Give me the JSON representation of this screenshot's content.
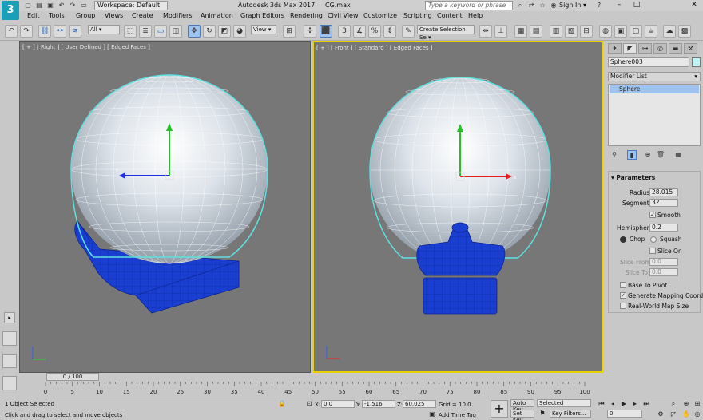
{
  "titlebar": {
    "workspace": "Workspace: Default",
    "app_title": "Autodesk 3ds Max 2017",
    "file_name": "CG.max",
    "search_placeholder": "Type a keyword or phrase",
    "sign_in": "Sign In"
  },
  "menu": [
    "Edit",
    "Tools",
    "Group",
    "Views",
    "Create",
    "Modifiers",
    "Animation",
    "Graph Editors",
    "Rendering",
    "Civil View",
    "Customize",
    "Scripting",
    "Content",
    "Help"
  ],
  "toolbar": {
    "filter_value": "All",
    "refcoord_value": "View",
    "selection_set": "Create Selection Se"
  },
  "viewports": {
    "right_label": "[ + ] [ Right ] [ User Defined ] [ Edged Faces ]",
    "front_label": "[ + ] [ Front ] [ Standard ] [ Edged Faces ]",
    "right_axis_z": "z",
    "front_axis_x": "x"
  },
  "command_panel": {
    "object_name": "Sphere003",
    "modifier_list": "Modifier List",
    "stack_item": "Sphere",
    "object_color": "#bff4f4",
    "rollout_title": "Parameters",
    "radius_label": "Radius:",
    "radius": "28.015",
    "segments_label": "Segments:",
    "segments": "32",
    "smooth": "Smooth",
    "hemisphere_label": "Hemisphere:",
    "hemisphere": "0.2",
    "chop": "Chop",
    "squash": "Squash",
    "slice_on": "Slice On",
    "slice_from_label": "Slice From:",
    "slice_from": "0.0",
    "slice_to_label": "Slice To:",
    "slice_to": "0.0",
    "base_to_pivot": "Base To Pivot",
    "gen_mapping": "Generate Mapping Coords.",
    "real_world": "Real-World Map Size"
  },
  "timeline": {
    "frame_display": "0 / 100",
    "ticks": [
      "0",
      "5",
      "10",
      "15",
      "20",
      "25",
      "30",
      "35",
      "40",
      "45",
      "50",
      "55",
      "60",
      "65",
      "70",
      "75",
      "80",
      "85",
      "90",
      "95",
      "100"
    ]
  },
  "status": {
    "selected": "1 Object Selected",
    "prompt": "Click and drag to select and move objects",
    "x_label": "X:",
    "x": "0.0",
    "y_label": "Y:",
    "y": "-1.516",
    "z_label": "Z:",
    "z": "60.025",
    "grid": "Grid = 10.0",
    "add_time_tag": "Add Time Tag",
    "auto_key": "Auto Key",
    "set_key": "Set Key",
    "selected_dd": "Selected",
    "key_filters": "Key Filters...",
    "frame": "0"
  },
  "colors": {
    "viewport_bg": "#777777",
    "active_border": "#e8d200",
    "sphere_wire": "#5fe0e0",
    "mesh_blue": "#1a3fd0"
  }
}
